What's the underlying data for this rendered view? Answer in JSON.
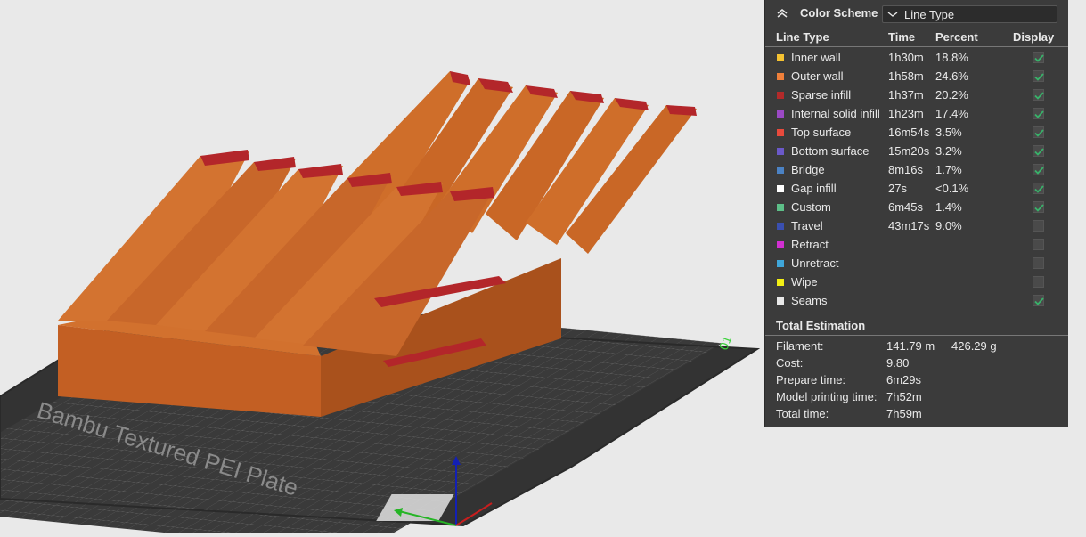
{
  "viewport": {
    "plate_label": "Bambu Textured PEI Plate",
    "plate_number": "01"
  },
  "panel": {
    "title": "Color Scheme",
    "scheme_select": "Line Type",
    "columns": {
      "type": "Line Type",
      "time": "Time",
      "percent": "Percent",
      "display": "Display"
    },
    "rows": [
      {
        "label": "Inner wall",
        "time": "1h30m",
        "percent": "18.8%",
        "color": "#f5c231",
        "display": true
      },
      {
        "label": "Outer wall",
        "time": "1h58m",
        "percent": "24.6%",
        "color": "#f0803a",
        "display": true
      },
      {
        "label": "Sparse infill",
        "time": "1h37m",
        "percent": "20.2%",
        "color": "#b32a2a",
        "display": true
      },
      {
        "label": "Internal solid infill",
        "time": "1h23m",
        "percent": "17.4%",
        "color": "#9b49c4",
        "display": true
      },
      {
        "label": "Top surface",
        "time": "16m54s",
        "percent": "3.5%",
        "color": "#e84a3c",
        "display": true
      },
      {
        "label": "Bottom surface",
        "time": "15m20s",
        "percent": "3.2%",
        "color": "#6b59c9",
        "display": true
      },
      {
        "label": "Bridge",
        "time": "8m16s",
        "percent": "1.7%",
        "color": "#4b82c4",
        "display": true
      },
      {
        "label": "Gap infill",
        "time": "27s",
        "percent": "<0.1%",
        "color": "#ffffff",
        "display": true
      },
      {
        "label": "Custom",
        "time": "6m45s",
        "percent": "1.4%",
        "color": "#5dbf88",
        "display": true
      },
      {
        "label": "Travel",
        "time": "43m17s",
        "percent": "9.0%",
        "color": "#3a4fb0",
        "display": false
      },
      {
        "label": "Retract",
        "time": "",
        "percent": "",
        "color": "#d12fd1",
        "display": false
      },
      {
        "label": "Unretract",
        "time": "",
        "percent": "",
        "color": "#3fa6d9",
        "display": false
      },
      {
        "label": "Wipe",
        "time": "",
        "percent": "",
        "color": "#f2ee14",
        "display": false
      },
      {
        "label": "Seams",
        "time": "",
        "percent": "",
        "color": "#e8e8e8",
        "display": true
      }
    ],
    "total": {
      "title": "Total Estimation",
      "filament_label": "Filament:",
      "filament_length": "141.79 m",
      "filament_weight": "426.29 g",
      "cost_label": "Cost:",
      "cost_value": "9.80",
      "prepare_label": "Prepare time:",
      "prepare_value": "6m29s",
      "model_label": "Model printing time:",
      "model_value": "7h52m",
      "total_label": "Total time:",
      "total_value": "7h59m"
    }
  }
}
